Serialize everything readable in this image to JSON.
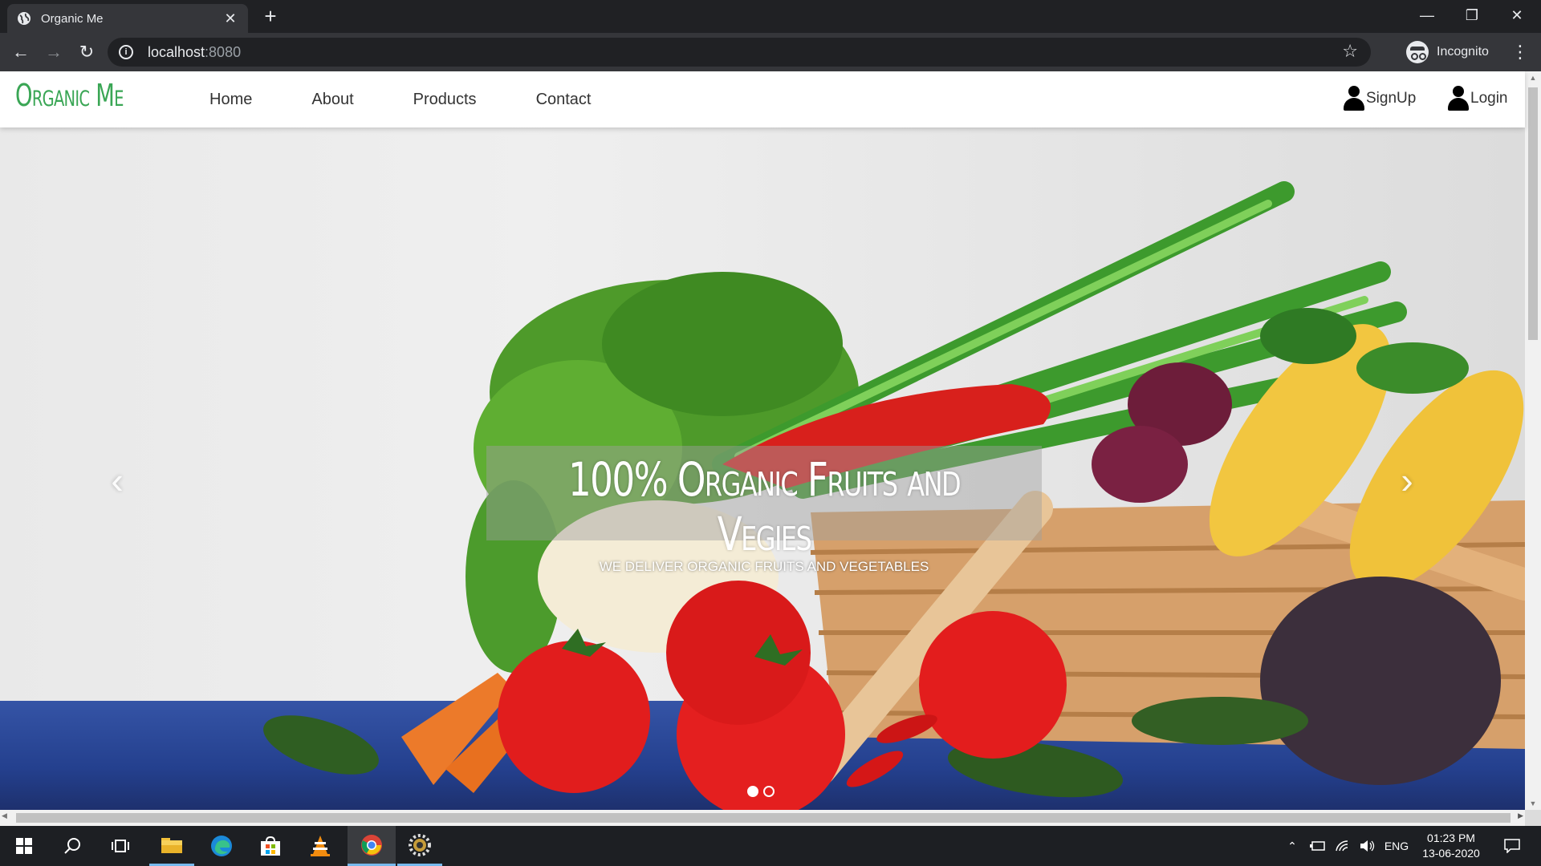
{
  "browser": {
    "tab_title": "Organic Me",
    "new_tab_icon": "plus-icon",
    "url_host": "localhost",
    "url_port": ":8080",
    "profile_label": "Incognito",
    "window_controls": [
      "minimize-icon",
      "restore-icon",
      "close-icon"
    ]
  },
  "site": {
    "logo": "Organic Me",
    "nav": [
      "Home",
      "About",
      "Products",
      "Contact"
    ],
    "signup_label": "SignUp",
    "login_label": "Login",
    "accent_color": "#3aa655"
  },
  "hero": {
    "title": "100% Organic Fruits and Vegies",
    "subtitle": "WE DELIVER ORGANIC FRUITS AND VEGETABLES",
    "prev_icon": "chevron-left-icon",
    "next_icon": "chevron-right-icon",
    "slides": 2,
    "active_slide": 1
  },
  "taskbar": {
    "apps": [
      "windows-start-icon",
      "search-icon",
      "task-view-icon",
      "file-explorer-icon",
      "edge-icon",
      "store-icon",
      "vlc-icon",
      "chrome-icon",
      "settings-app-icon"
    ],
    "language": "ENG",
    "time": "01:23 PM",
    "date": "13-06-2020"
  }
}
